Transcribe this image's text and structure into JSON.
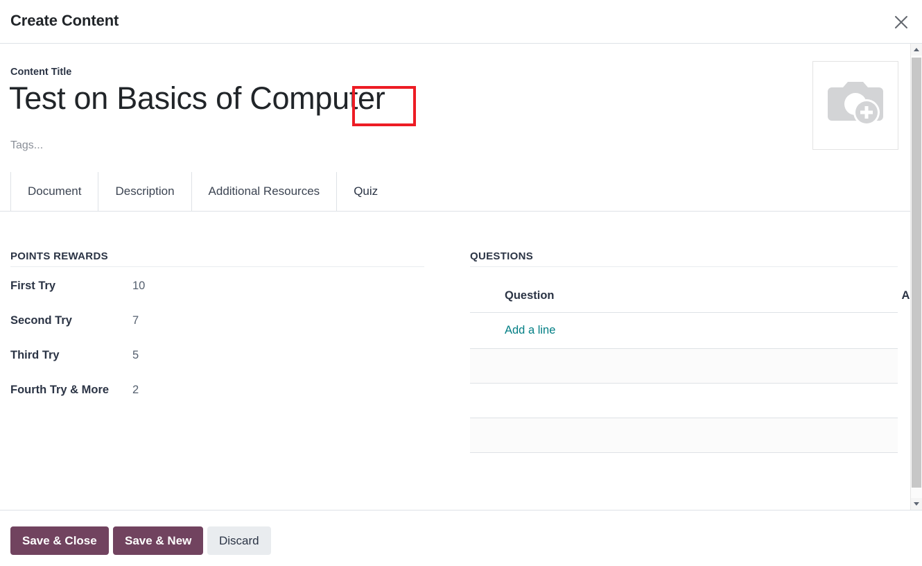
{
  "dialog": {
    "title": "Create Content",
    "close_icon": "close-icon"
  },
  "form": {
    "content_title_label": "Content Title",
    "content_title_value": "Test on Basics of Computer",
    "tags_placeholder": "Tags...",
    "image_placeholder_icon": "camera-add-icon"
  },
  "tabs": [
    {
      "label": "Document",
      "active": false
    },
    {
      "label": "Description",
      "active": false
    },
    {
      "label": "Additional Resources",
      "active": false
    },
    {
      "label": "Quiz",
      "active": true
    }
  ],
  "highlight": {
    "target_tab": "Quiz",
    "color": "#ed1c24"
  },
  "points_rewards": {
    "section_title": "POINTS REWARDS",
    "rows": [
      {
        "label": "First Try",
        "value": "10"
      },
      {
        "label": "Second Try",
        "value": "7"
      },
      {
        "label": "Third Try",
        "value": "5"
      },
      {
        "label": "Fourth Try & More",
        "value": "2"
      }
    ]
  },
  "questions": {
    "section_title": "QUESTIONS",
    "columns": {
      "question": "Question",
      "answers": "Answers"
    },
    "add_line_label": "Add a line",
    "rows": []
  },
  "footer": {
    "save_close_label": "Save & Close",
    "save_new_label": "Save & New",
    "discard_label": "Discard",
    "primary_color": "#71435f"
  },
  "scrollbar": {
    "up_icon": "chevron-up-icon",
    "down_icon": "chevron-down-icon"
  }
}
